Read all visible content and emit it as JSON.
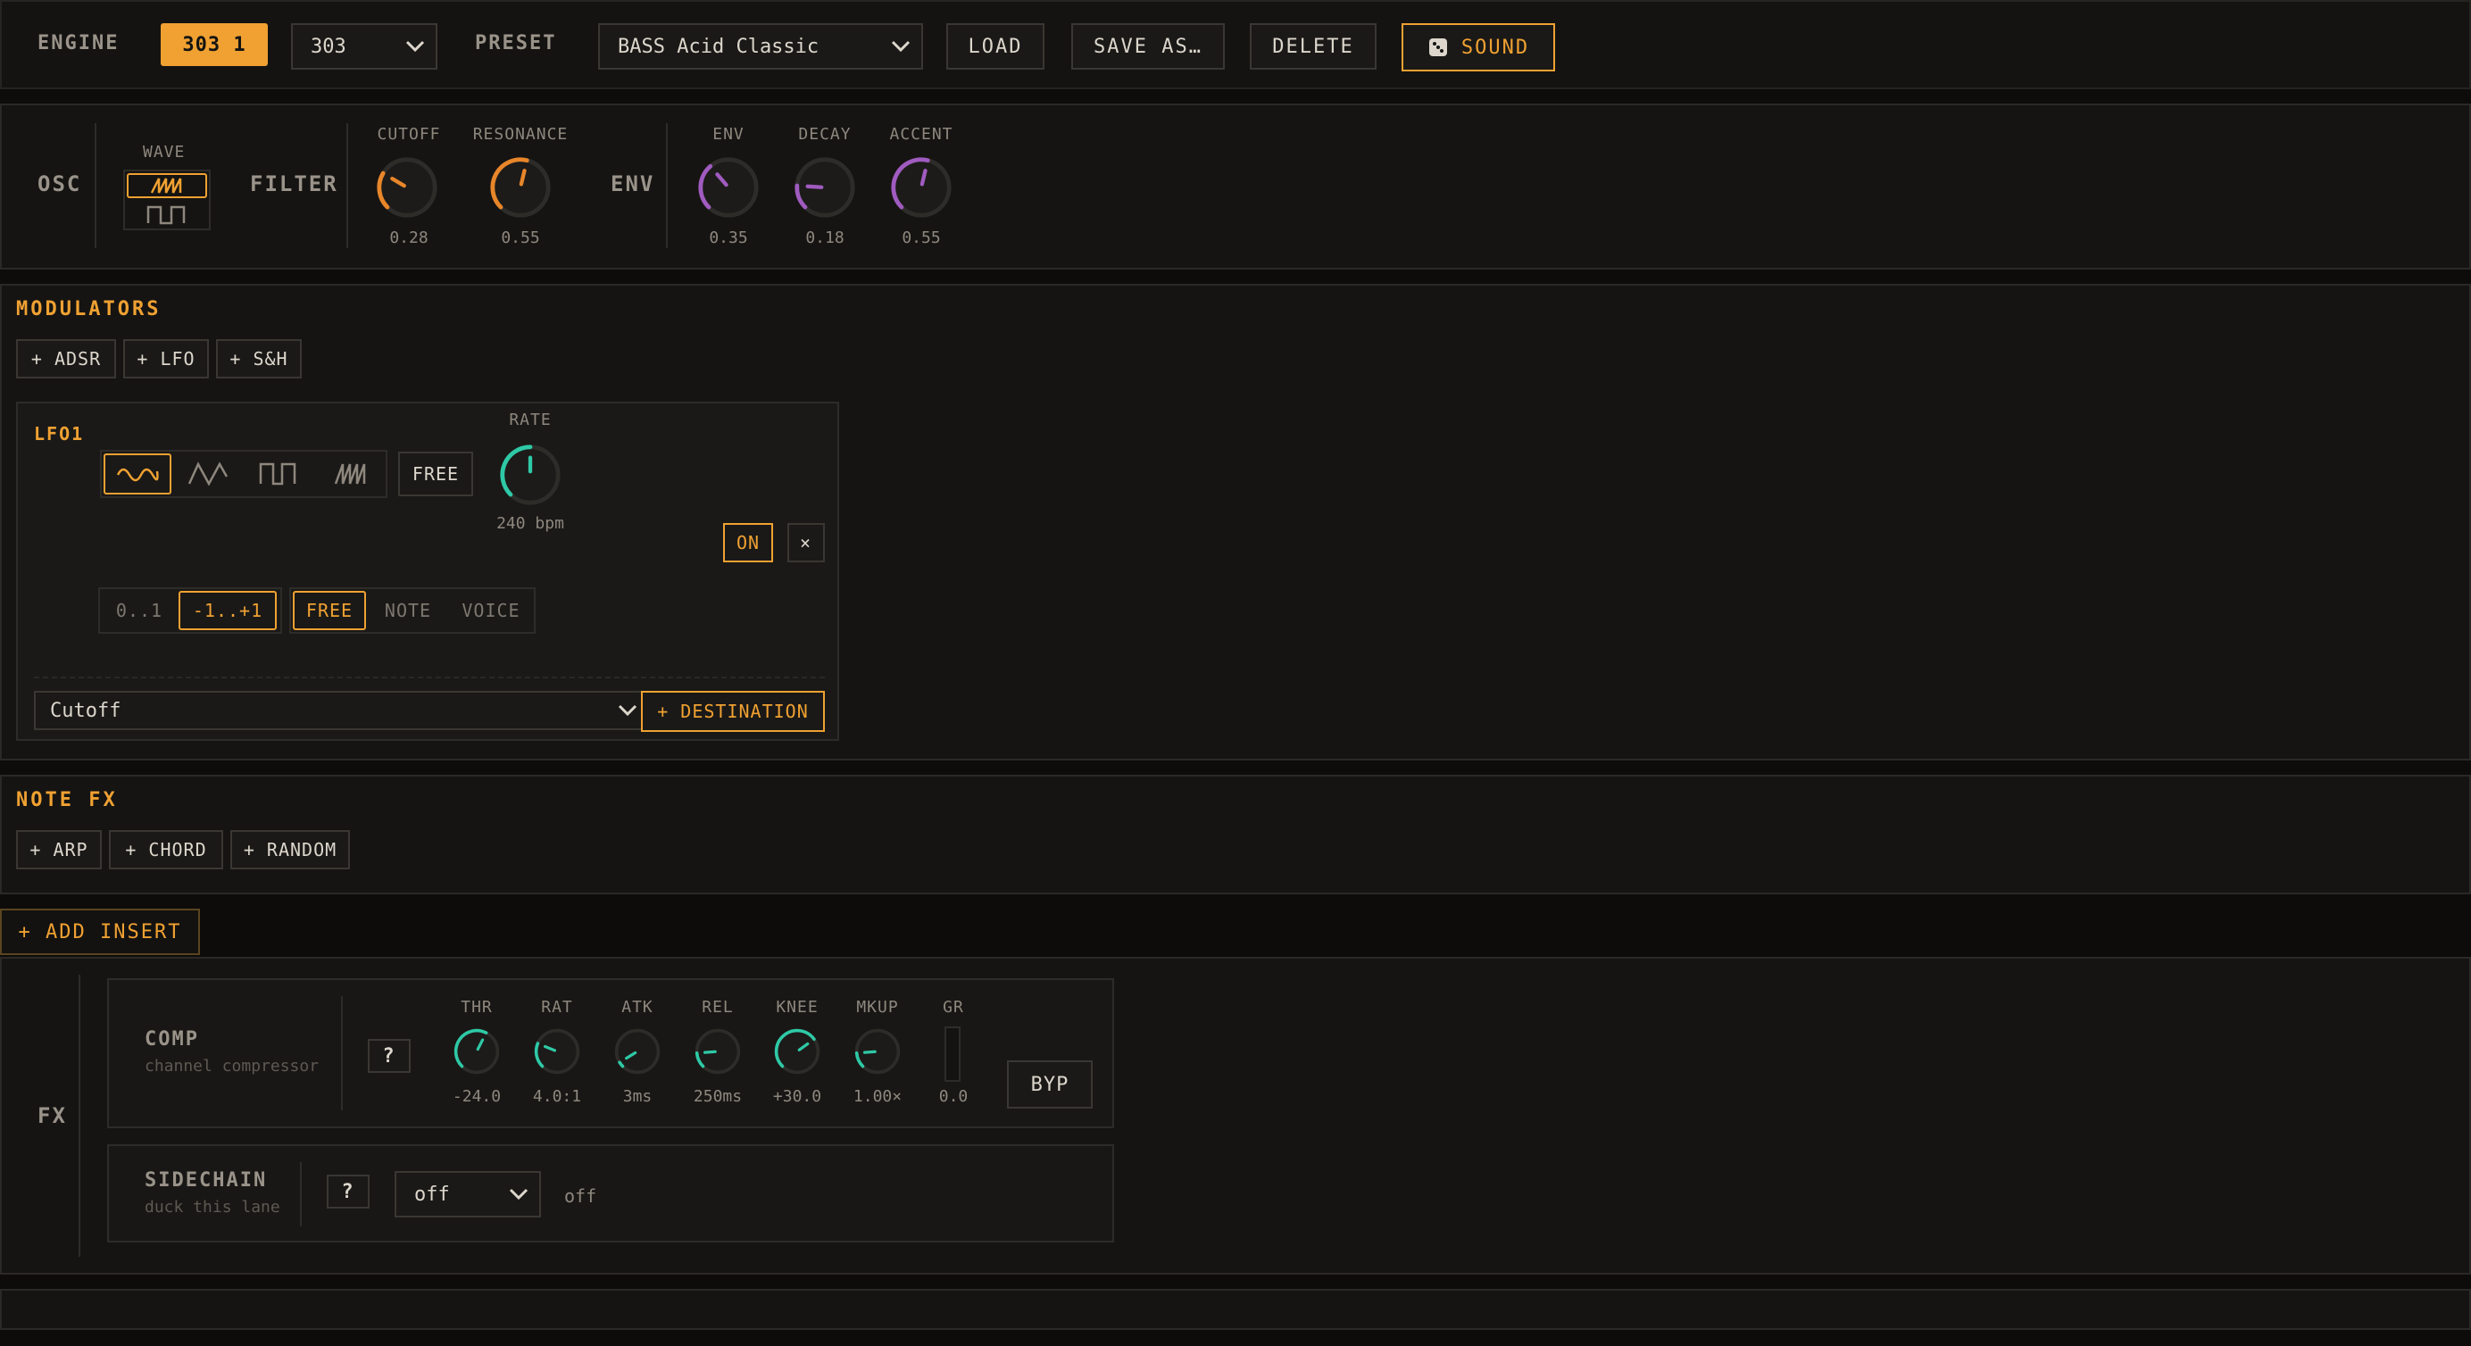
{
  "topbar": {
    "engine_label": "ENGINE",
    "engine_badge": "303 1",
    "engine_select": "303",
    "preset_label": "PRESET",
    "preset_select": "BASS Acid Classic",
    "load_label": "LOAD",
    "save_as_label": "SAVE AS…",
    "delete_label": "DELETE",
    "sound_label": "SOUND"
  },
  "synth": {
    "osc_label": "OSC",
    "wave_label": "WAVE",
    "filter_label": "FILTER",
    "env_section_label": "ENV",
    "knobs": [
      {
        "label": "CUTOFF",
        "value": "0.28",
        "level": 0.28,
        "color": "#e8862a"
      },
      {
        "label": "RESONANCE",
        "value": "0.55",
        "level": 0.55,
        "color": "#e8862a"
      },
      {
        "label": "ENV",
        "value": "0.35",
        "level": 0.35,
        "color": "#a05bc0"
      },
      {
        "label": "DECAY",
        "value": "0.18",
        "level": 0.18,
        "color": "#a05bc0"
      },
      {
        "label": "ACCENT",
        "value": "0.55",
        "level": 0.55,
        "color": "#a05bc0"
      }
    ]
  },
  "modulators": {
    "title": "MODULATORS",
    "add_buttons": [
      "+ ADSR",
      "+ LFO",
      "+ S&H"
    ],
    "lfo": {
      "name": "LFO1",
      "free_label": "FREE",
      "rate_label": "RATE",
      "rate_value": "240 bpm",
      "rate_level": 0.5,
      "on_label": "ON",
      "close_label": "×",
      "range_options": [
        "0..1",
        "-1..+1"
      ],
      "trigger_options": [
        "FREE",
        "NOTE",
        "VOICE"
      ],
      "destination_select": "Cutoff",
      "add_destination_label": "+ DESTINATION"
    }
  },
  "note_fx": {
    "title": "NOTE FX",
    "add_buttons": [
      "+ ARP",
      "+ CHORD",
      "+ RANDOM"
    ]
  },
  "add_insert_label": "+ ADD INSERT",
  "fx": {
    "label": "FX",
    "comp": {
      "title": "COMP",
      "subtitle": "channel compressor",
      "help": "?",
      "knobs": [
        {
          "label": "THR",
          "value": "-24.0",
          "level": 0.6
        },
        {
          "label": "RAT",
          "value": "4.0:1",
          "level": 0.25
        },
        {
          "label": "ATK",
          "value": "3ms",
          "level": 0.05
        },
        {
          "label": "REL",
          "value": "250ms",
          "level": 0.15
        },
        {
          "label": "KNEE",
          "value": "+30.0",
          "level": 0.7
        },
        {
          "label": "MKUP",
          "value": "1.00×",
          "level": 0.15
        }
      ],
      "gr_label": "GR",
      "gr_value": "0.0",
      "bypass_label": "BYP"
    },
    "sidechain": {
      "title": "SIDECHAIN",
      "subtitle": "duck this lane",
      "help": "?",
      "select": "off",
      "status": "off"
    }
  },
  "colors": {
    "accent": "#f0a132",
    "teal": "#2ec9a6",
    "orange_knob": "#e8862a",
    "purple_knob": "#a05bc0"
  }
}
